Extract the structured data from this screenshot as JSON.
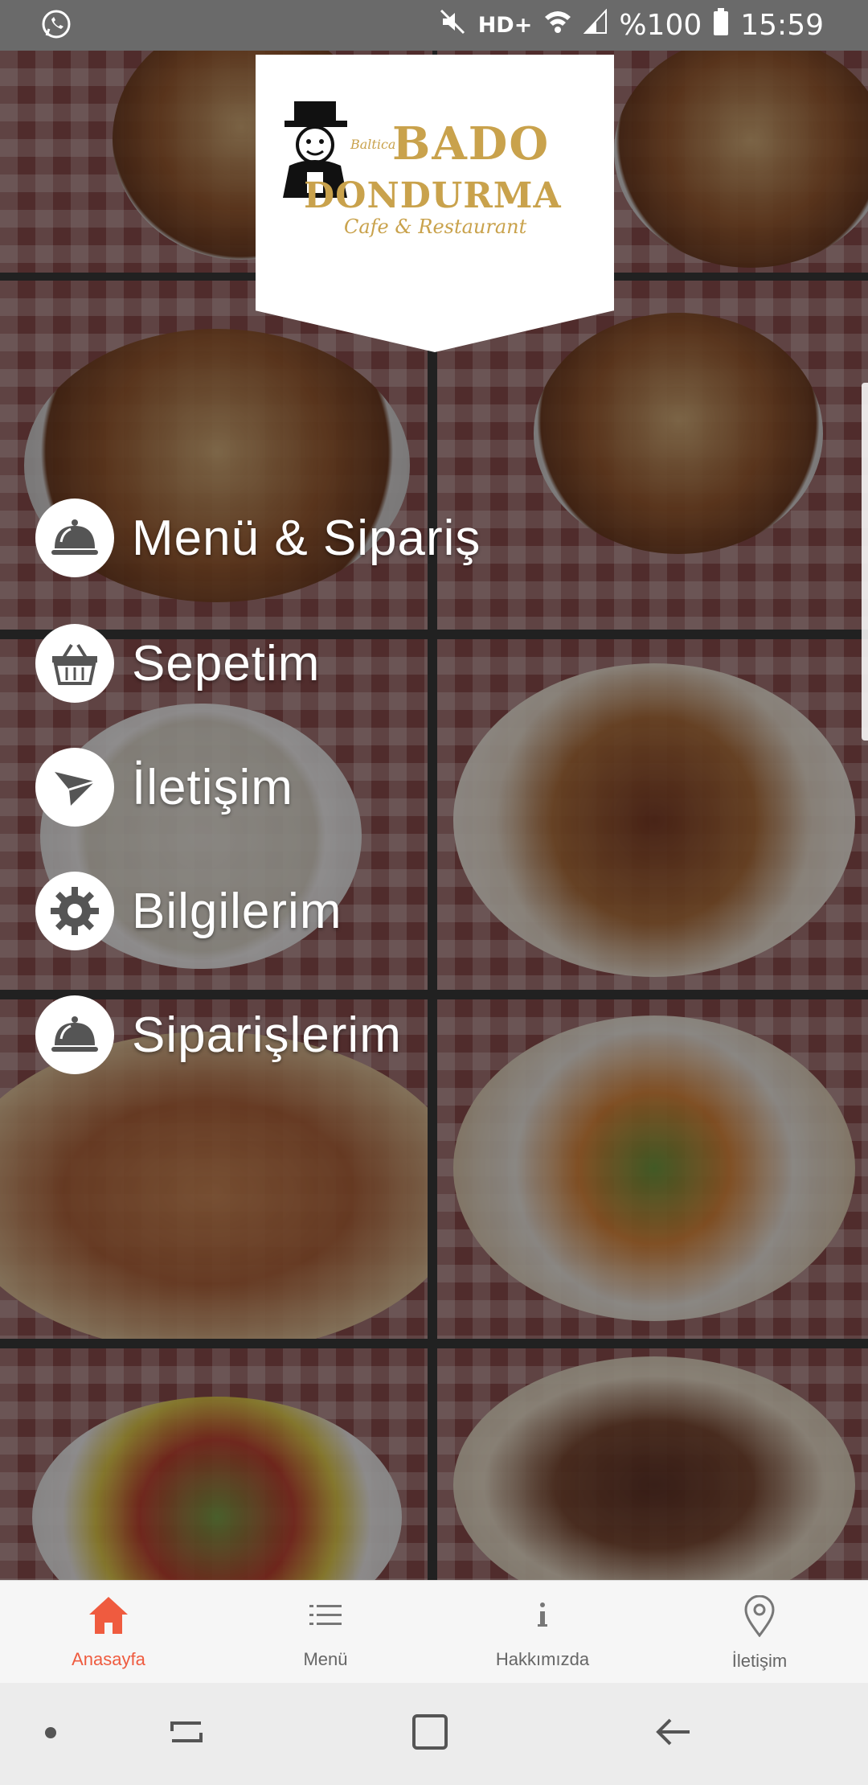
{
  "status_bar": {
    "network": "HD+",
    "battery": "%100",
    "time": "15:59"
  },
  "logo": {
    "brand_small": "Baltica",
    "brand": "BADO",
    "name": "DONDURMA",
    "tagline": "Cafe & Restaurant"
  },
  "side_menu": {
    "items": [
      {
        "label": "Menü & Sipariş",
        "icon": "cloche-icon"
      },
      {
        "label": "Sepetim",
        "icon": "basket-icon"
      },
      {
        "label": "İletişim",
        "icon": "send-icon"
      },
      {
        "label": "Bilgilerim",
        "icon": "gear-icon"
      },
      {
        "label": "Siparişlerim",
        "icon": "cloche-icon"
      }
    ]
  },
  "tab_bar": {
    "active": "Anasayfa",
    "accent_color": "#ef5b3f",
    "tabs": [
      {
        "label": "Anasayfa",
        "icon": "home-icon"
      },
      {
        "label": "Menü",
        "icon": "list-icon"
      },
      {
        "label": "Hakkımızda",
        "icon": "info-icon"
      },
      {
        "label": "İletişim",
        "icon": "location-pin-icon"
      }
    ]
  }
}
